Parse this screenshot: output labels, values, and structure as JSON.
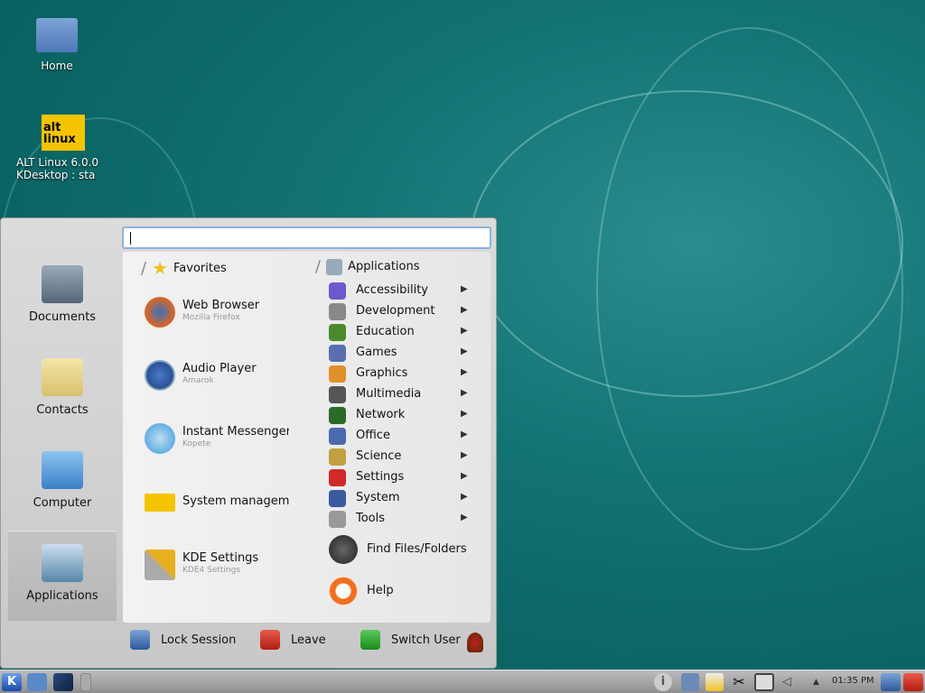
{
  "desktop": {
    "icons": [
      {
        "label": "Home",
        "icon": "folder-home-icon"
      },
      {
        "label": "ALT Linux 6.0.0\nKDesktop : sta",
        "line1": "ALT Linux 6.0.0",
        "line2": "KDesktop : sta",
        "icon": "altlinux-logo"
      }
    ]
  },
  "menu": {
    "search": {
      "value": "",
      "placeholder": ""
    },
    "left": [
      {
        "label": "Documents",
        "icon": "typewriter-icon"
      },
      {
        "label": "Contacts",
        "icon": "address-book-icon"
      },
      {
        "label": "Computer",
        "icon": "laptop-icon"
      },
      {
        "label": "Applications",
        "icon": "applications-icon",
        "active": true
      }
    ],
    "favorites_title": "Favorites",
    "applications_title": "Applications",
    "favorites": [
      {
        "title": "Web Browser",
        "subtitle": "Mozilla Firefox",
        "icon": "firefox-icon",
        "color": "#e0661c"
      },
      {
        "title": "Audio Player",
        "subtitle": "Amarok",
        "icon": "amarok-icon",
        "color": "#2a5ea8"
      },
      {
        "title": "Instant Messenger",
        "subtitle": "Kopete",
        "icon": "kopete-icon",
        "color": "#3c9ae0"
      },
      {
        "title": "System management",
        "subtitle": "",
        "icon": "altlinux-icon",
        "color": "#f5c400"
      },
      {
        "title": "KDE Settings",
        "subtitle": "KDE4 Settings",
        "icon": "tools-icon",
        "color": "#888888"
      }
    ],
    "categories": [
      {
        "label": "Accessibility",
        "icon": "accessibility-icon",
        "color": "#6a5acd"
      },
      {
        "label": "Development",
        "icon": "development-icon",
        "color": "#888888"
      },
      {
        "label": "Education",
        "icon": "education-icon",
        "color": "#4a8a2a"
      },
      {
        "label": "Games",
        "icon": "games-icon",
        "color": "#5a6fb0"
      },
      {
        "label": "Graphics",
        "icon": "graphics-icon",
        "color": "#e0902a"
      },
      {
        "label": "Multimedia",
        "icon": "multimedia-icon",
        "color": "#555555"
      },
      {
        "label": "Network",
        "icon": "network-icon",
        "color": "#2a6a2a"
      },
      {
        "label": "Office",
        "icon": "office-icon",
        "color": "#4a6ab0"
      },
      {
        "label": "Science",
        "icon": "science-icon",
        "color": "#c0a040"
      },
      {
        "label": "Settings",
        "icon": "settings-icon",
        "color": "#d02a2a"
      },
      {
        "label": "System",
        "icon": "system-icon",
        "color": "#3a5aa0"
      },
      {
        "label": "Tools",
        "icon": "tools-icon",
        "color": "#999999"
      }
    ],
    "find": "Find Files/Folders",
    "help": "Help",
    "bottom": {
      "lock": "Lock Session",
      "leave": "Leave",
      "switch": "Switch User"
    }
  },
  "taskbar": {
    "clock": "01:35 PM"
  }
}
